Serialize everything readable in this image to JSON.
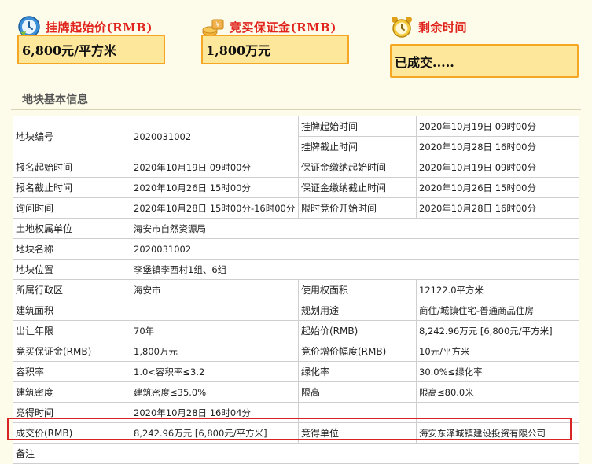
{
  "stats": {
    "start_price": {
      "title": "挂牌起始价(RMB)",
      "value": "6,800元/平方米",
      "icon": "clock-refresh-icon"
    },
    "deposit": {
      "title": "竞买保证金(RMB)",
      "value": "1,800万元",
      "icon": "money-coins-icon"
    },
    "remaining": {
      "title": "剩余时间",
      "value": "已成交.....",
      "icon": "alarm-clock-icon"
    }
  },
  "section_title": "地块基本信息",
  "parcel": {
    "code_label": "地块编号",
    "code": "2020031002",
    "list_start_label": "挂牌起始时间",
    "list_start": "2020年10月19日 09时00分",
    "list_end_label": "挂牌截止时间",
    "list_end": "2020年10月28日 16时00分",
    "reg_start_label": "报名起始时间",
    "reg_start": "2020年10月19日 09时00分",
    "dep_start_label": "保证金缴纳起始时间",
    "dep_start": "2020年10月19日 09时00分",
    "reg_end_label": "报名截止时间",
    "reg_end": "2020年10月26日 15时00分",
    "dep_end_label": "保证金缴纳截止时间",
    "dep_end": "2020年10月26日 15时00分",
    "inquiry_label": "询问时间",
    "inquiry": "2020年10月28日 15时00分-16时00分",
    "limit_label": "限时竞价开始时间",
    "limit": "2020年10月28日 16时00分",
    "owner_label": "土地权属单位",
    "owner": "海安市自然资源局",
    "name_label": "地块名称",
    "name": "2020031002",
    "location_label": "地块位置",
    "location": "李堡镇李西村1组、6组",
    "district_label": "所属行政区",
    "district": "海安市",
    "area_label": "使用权面积",
    "area": "12122.0平方米",
    "build_area_label": "建筑面积",
    "build_area": "",
    "usage_label": "规划用途",
    "usage": "商住/城镇住宅-普通商品住房",
    "term_label": "出让年限",
    "term": "70年",
    "start_price_label": "起始价(RMB)",
    "start_price": "8,242.96万元 [6,800元/平方米]",
    "deposit_label": "竞买保证金(RMB)",
    "deposit": "1,800万元",
    "increment_label": "竞价增价幅度(RMB)",
    "increment": "10元/平方米",
    "far_label": "容积率",
    "far": "1.0<容积率≤3.2",
    "green_label": "绿化率",
    "green": "30.0%≤绿化率",
    "density_label": "建筑密度",
    "density": "建筑密度≤35.0%",
    "height_label": "限高",
    "height": "限高≤80.0米",
    "won_time_label": "竞得时间",
    "won_time": "2020年10月28日 16时04分",
    "deal_price_label": "成交价(RMB)",
    "deal_price": "8,242.96万元 [6,800元/平方米]",
    "winner_label": "竞得单位",
    "winner": "海安东泽城镇建设投资有限公司",
    "remark_label": "备注",
    "remark": ""
  },
  "colors": {
    "accent_red": "#e0231c",
    "box_fill": "#fce79a",
    "box_border": "#f5a623",
    "highlight": "#d82424"
  }
}
